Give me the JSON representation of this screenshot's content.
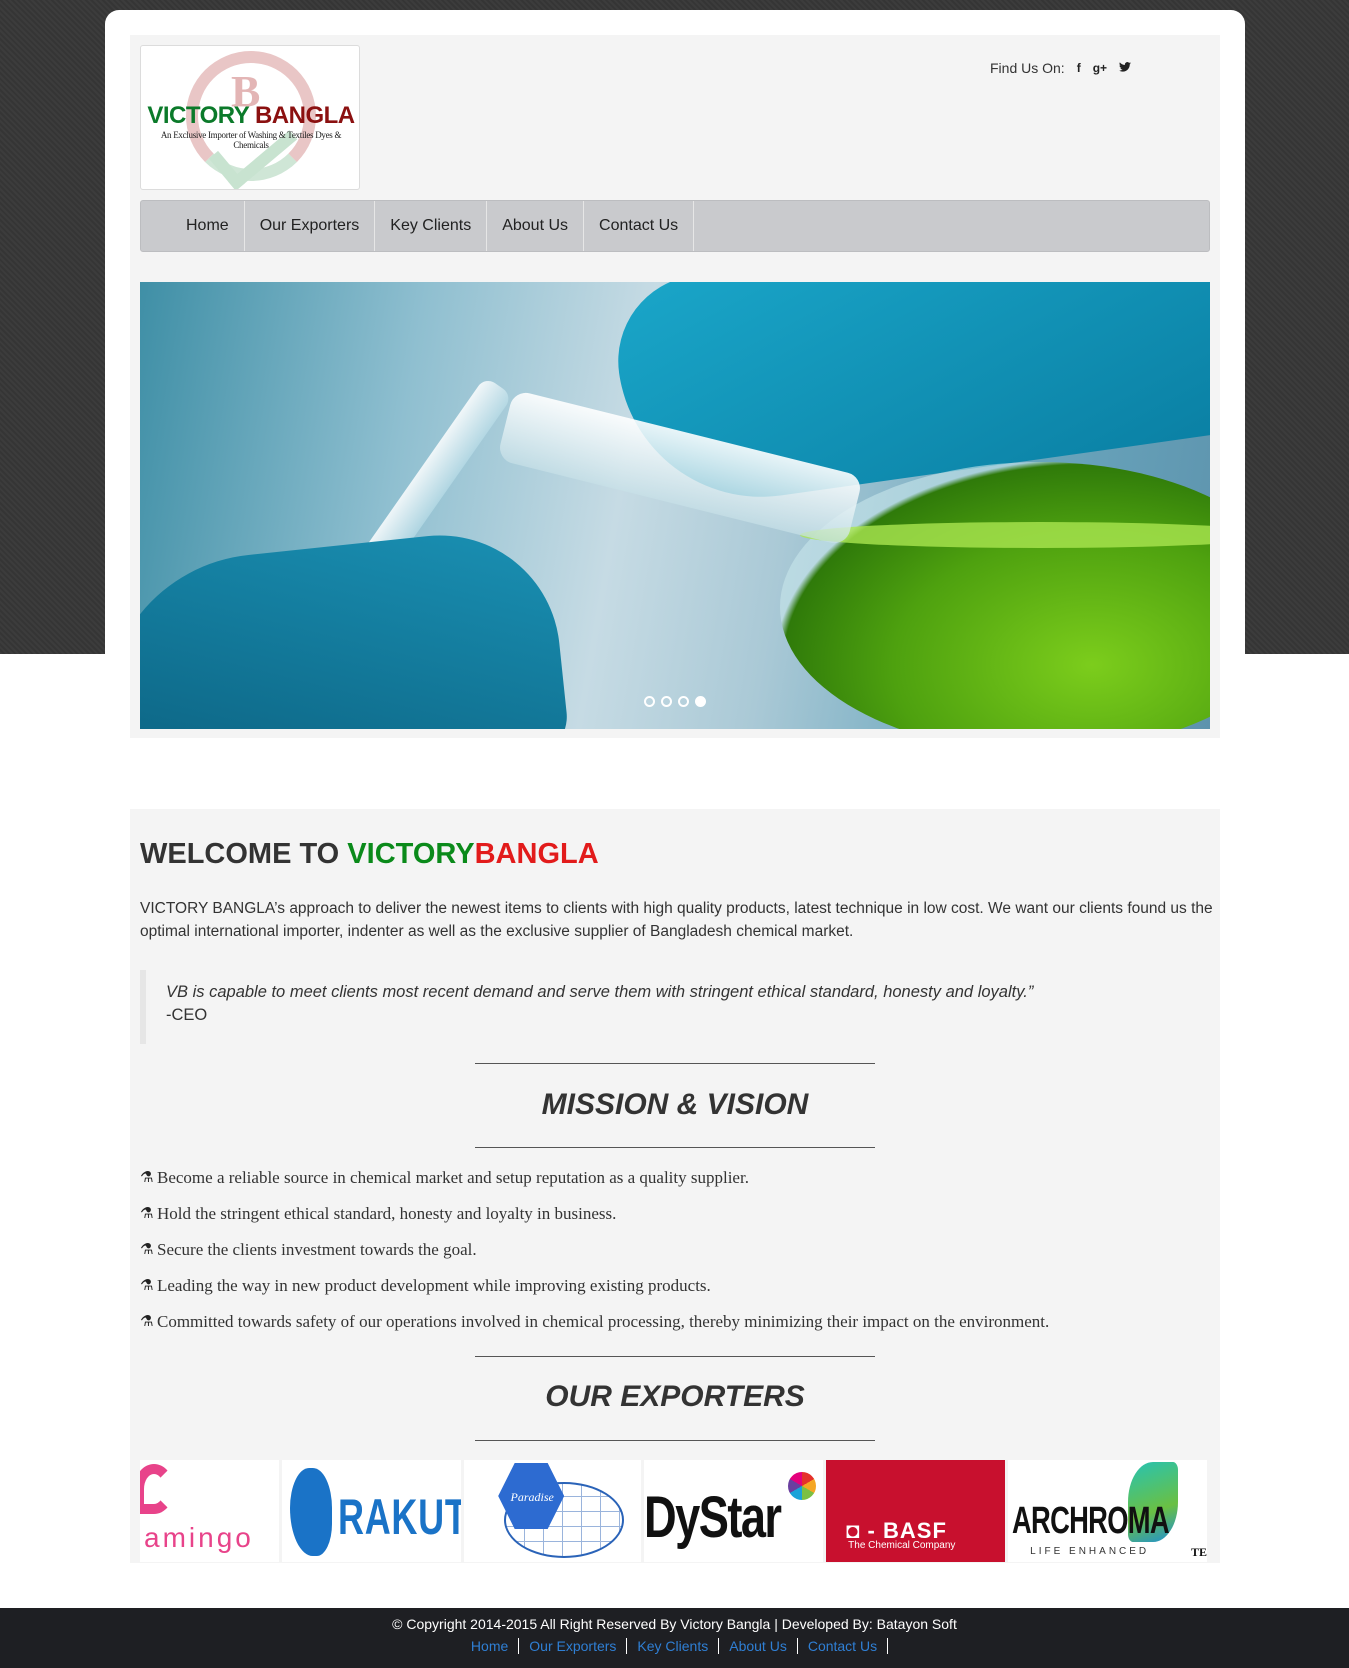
{
  "logo": {
    "title_part1": "VICTORY",
    "title_part2": "BANGLA",
    "tagline": "An Exclusive Importer of Washing & Textiles Dyes & Chemicals",
    "letter": "B",
    "colors": {
      "green": "#0b7a2a",
      "red": "#8b1010"
    }
  },
  "header": {
    "find_us_label": "Find Us On:",
    "social": [
      {
        "icon": "facebook-icon",
        "glyph": "f"
      },
      {
        "icon": "google-plus-icon",
        "glyph": "g+"
      },
      {
        "icon": "twitter-icon",
        "glyph": "t"
      }
    ]
  },
  "nav": {
    "items": [
      "Home",
      "Our Exporters",
      "Key Clients",
      "About Us",
      "Contact Us"
    ]
  },
  "slider": {
    "image": "lab-glass-flask-green-liquid",
    "slide_count": 4,
    "active_slide": 4
  },
  "welcome": {
    "prefix": "WELCOME TO ",
    "green": "VICTORY",
    "red": "BANGLA",
    "intro": "VICTORY BANGLA’s approach to deliver the newest items to clients with high quality products, latest technique in low cost. We want our clients found us the optimal international importer, indenter as well as the exclusive supplier of Bangladesh chemical market.",
    "quote": "VB is capable to meet clients most recent demand and serve them with stringent ethical standard, honesty and loyalty.”",
    "quote_cite": "-CEO"
  },
  "mission": {
    "title": "MISSION & VISION",
    "icon": "flask-icon",
    "items": [
      "Become a reliable source in chemical market and setup reputation as a quality supplier.",
      "Hold the stringent ethical standard, honesty and loyalty in business.",
      "Secure the clients investment towards the goal.",
      "Leading the way in new product development while improving existing products.",
      "Committed towards safety of our operations involved in chemical processing, thereby minimizing their impact on the environment."
    ]
  },
  "exporters": {
    "title": "OUR EXPORTERS",
    "logos": [
      {
        "name": "flamingo-logo",
        "text": "amingo"
      },
      {
        "name": "rakuto-logo",
        "text": "RAKUTO"
      },
      {
        "name": "paradise-logo",
        "text": "Paradise"
      },
      {
        "name": "dystar-logo",
        "text": "DyStar"
      },
      {
        "name": "basf-logo",
        "text": "BASF",
        "sub": "The Chemical Company"
      },
      {
        "name": "archroma-logo",
        "text": "ARCHROMA",
        "sub": "LIFE ENHANCED",
        "extra": "TE"
      }
    ]
  },
  "footer": {
    "copyright": "© Copyright 2014-2015 All Right Reserved By Victory Bangla | Developed By: Batayon Soft",
    "links": [
      "Home",
      "Our Exporters",
      "Key Clients",
      "About Us",
      "Contact Us"
    ]
  }
}
